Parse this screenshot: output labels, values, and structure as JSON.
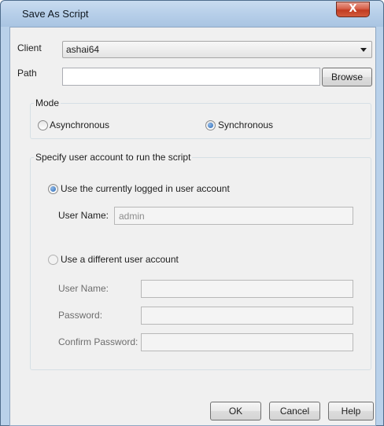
{
  "window": {
    "title": "Save As Script",
    "close_symbol": "X"
  },
  "client": {
    "label": "Client",
    "value": "ashai64"
  },
  "path": {
    "label": "Path",
    "value": "",
    "browse_label": "Browse"
  },
  "mode": {
    "title": "Mode",
    "options": [
      {
        "label": "Asynchronous",
        "checked": false
      },
      {
        "label": "Synchronous",
        "checked": true
      }
    ]
  },
  "account": {
    "title": "Specify user account to run the script",
    "current": {
      "label": "Use the currently logged in user account",
      "checked": true,
      "username_label": "User Name:",
      "username_value": "admin"
    },
    "different": {
      "label": "Use a different user account",
      "checked": false,
      "username_label": "User Name:",
      "password_label": "Password:",
      "confirm_label": "Confirm Password:",
      "username_value": "",
      "password_value": "",
      "confirm_value": ""
    }
  },
  "buttons": {
    "ok": "OK",
    "cancel": "Cancel",
    "help": "Help"
  }
}
